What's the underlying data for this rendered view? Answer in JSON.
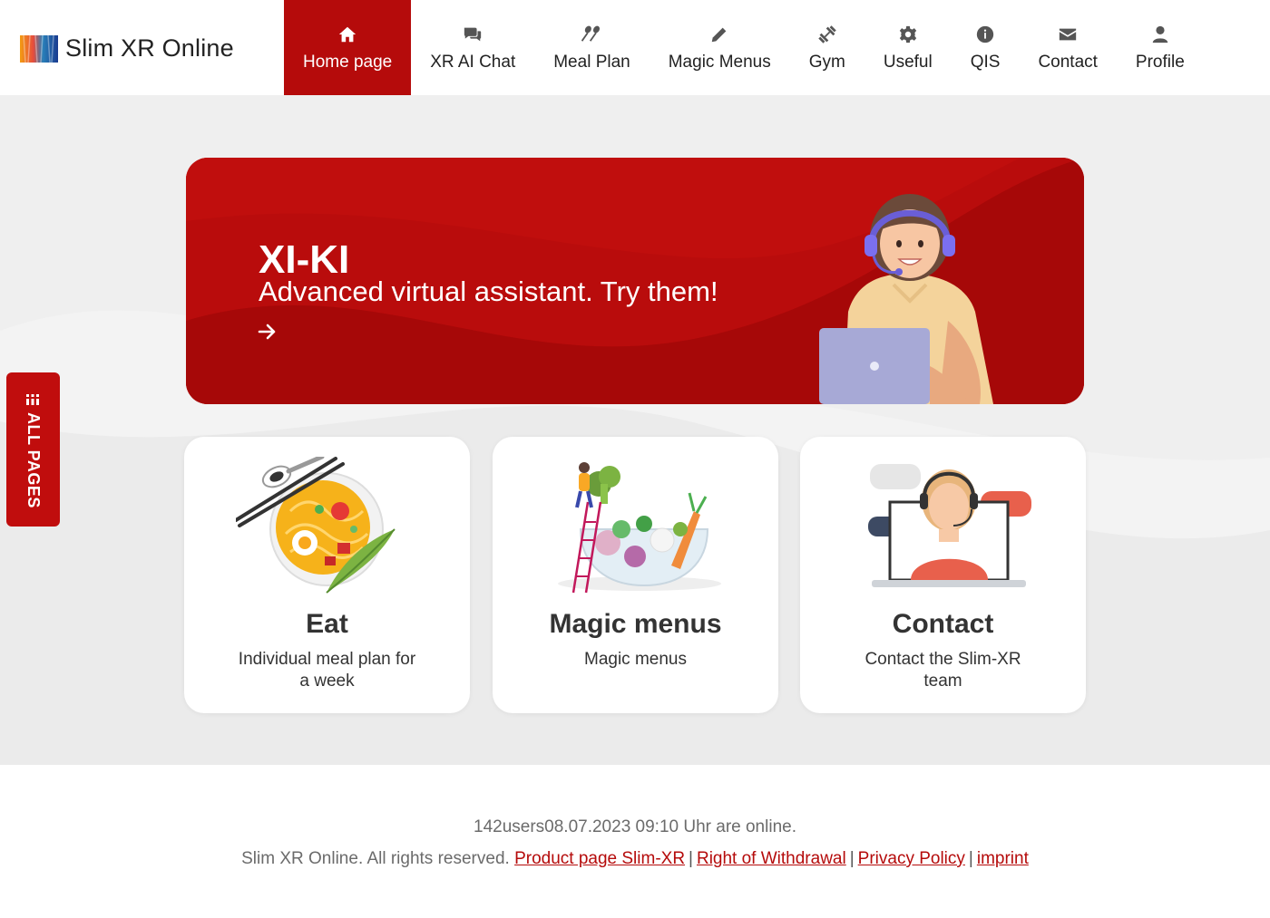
{
  "brand": {
    "name": "Slim XR Online",
    "logo_icon": "gradient-logo-icon"
  },
  "nav": {
    "items": [
      {
        "label": "Home page",
        "icon": "home-icon",
        "active": true
      },
      {
        "label": "XR AI Chat",
        "icon": "chat-icon",
        "active": false
      },
      {
        "label": "Meal Plan",
        "icon": "spoons-icon",
        "active": false
      },
      {
        "label": "Magic Menus",
        "icon": "pencil-icon",
        "active": false
      },
      {
        "label": "Gym",
        "icon": "dumbbell-icon",
        "active": false
      },
      {
        "label": "Useful",
        "icon": "gear-icon",
        "active": false
      },
      {
        "label": "QIS",
        "icon": "info-icon",
        "active": false
      },
      {
        "label": "Contact",
        "icon": "envelope-icon",
        "active": false
      },
      {
        "label": "Profile",
        "icon": "user-icon",
        "active": false
      }
    ]
  },
  "hero": {
    "title": "XI-KI",
    "subtitle": "Advanced virtual assistant. Try them!",
    "arrow_icon": "arrow-right-icon"
  },
  "cards": [
    {
      "title": "Eat",
      "description": "Individual meal plan for a week",
      "image": "noodle-bowl-illustration"
    },
    {
      "title": "Magic menus",
      "description": "Magic menus",
      "image": "salad-bowl-illustration"
    },
    {
      "title": "Contact",
      "description": "Contact the Slim-XR team",
      "image": "support-agent-illustration"
    }
  ],
  "side_tab": {
    "label": "ALL PAGES",
    "icon": "dots-grid-icon"
  },
  "footer": {
    "online_text": "142users08.07.2023 09:10 Uhr are online.",
    "rights_text": "Slim XR Online. All rights reserved.",
    "links": [
      "Product page Slim-XR",
      "Right of Withdrawal",
      "Privacy Policy",
      "imprint"
    ]
  },
  "colors": {
    "accent": "#b50b0b",
    "page_bg": "#efefef",
    "card_bg": "#ffffff"
  }
}
